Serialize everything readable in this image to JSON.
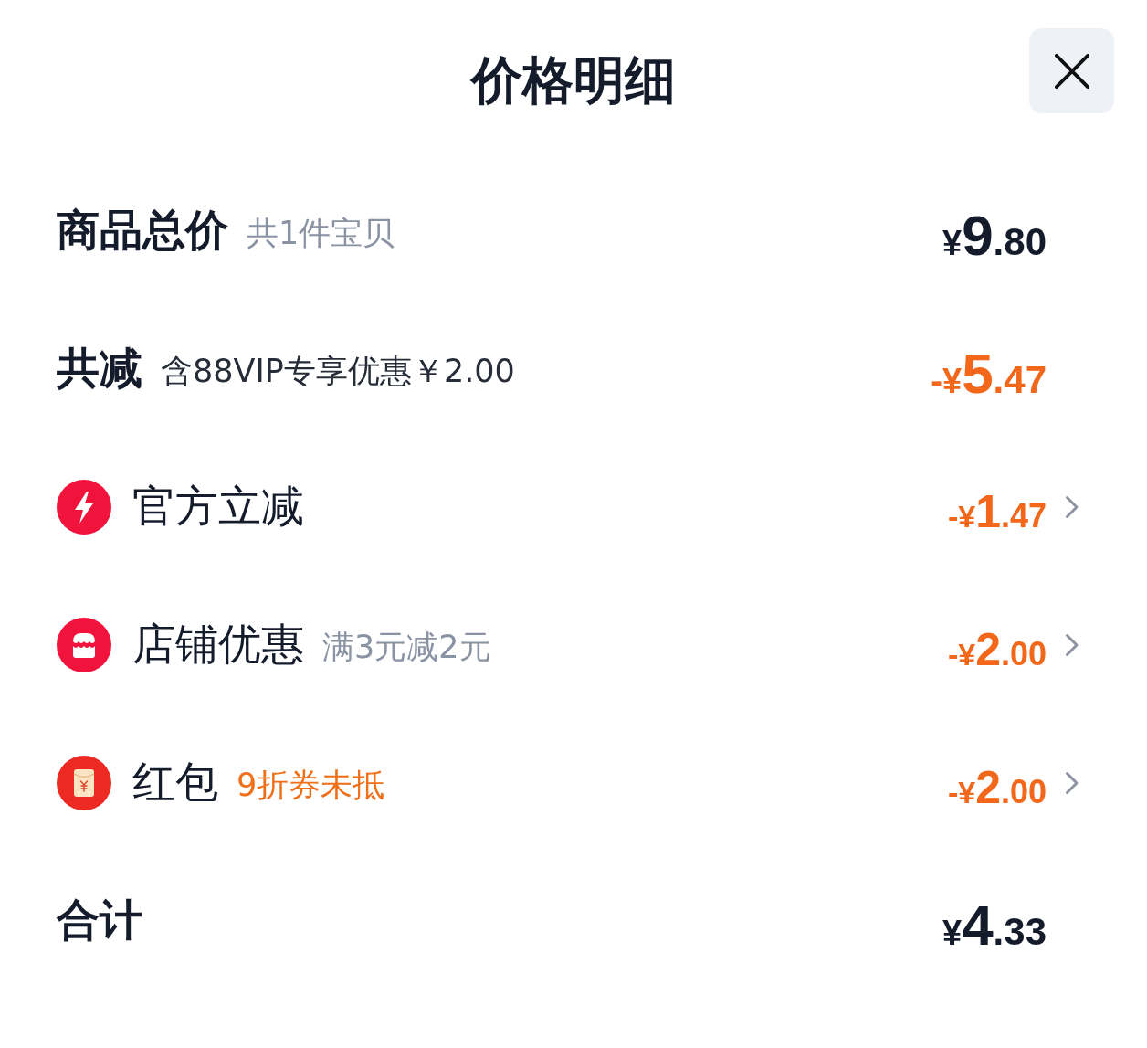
{
  "sheet": {
    "title": "价格明细"
  },
  "rows": [
    {
      "kind": "summary",
      "label": "商品总价",
      "note": {
        "text": "共1件宝贝",
        "color": "#8a93a3"
      },
      "amount": {
        "symbol": "¥",
        "whole": "9",
        "fraction": ".80",
        "color": "#141c2b"
      }
    },
    {
      "kind": "summary",
      "label": "共减",
      "note": {
        "text": "含88VIP专享优惠￥2.00",
        "color": "#262c38"
      },
      "amount": {
        "symbol": "-¥",
        "whole": "5",
        "fraction": ".47",
        "color": "#f2671a"
      }
    },
    {
      "kind": "flash",
      "label": "官方立减",
      "amount": {
        "symbol": "-¥",
        "whole": "1",
        "fraction": ".47",
        "color": "#f2671a"
      }
    },
    {
      "kind": "store",
      "label": "店铺优惠",
      "note": {
        "text": "满3元减2元",
        "color": "#8a93a3"
      },
      "amount": {
        "symbol": "-¥",
        "whole": "2",
        "fraction": ".00",
        "color": "#f2671a"
      }
    },
    {
      "kind": "packet",
      "label": "红包",
      "note": {
        "text": "9折券未抵",
        "color": "#f0701a"
      },
      "amount": {
        "symbol": "-¥",
        "whole": "2",
        "fraction": ".00",
        "color": "#f2671a"
      }
    },
    {
      "kind": "summary",
      "label": "合计",
      "amount": {
        "symbol": "¥",
        "whole": "4",
        "fraction": ".33",
        "color": "#141c2b"
      }
    }
  ]
}
